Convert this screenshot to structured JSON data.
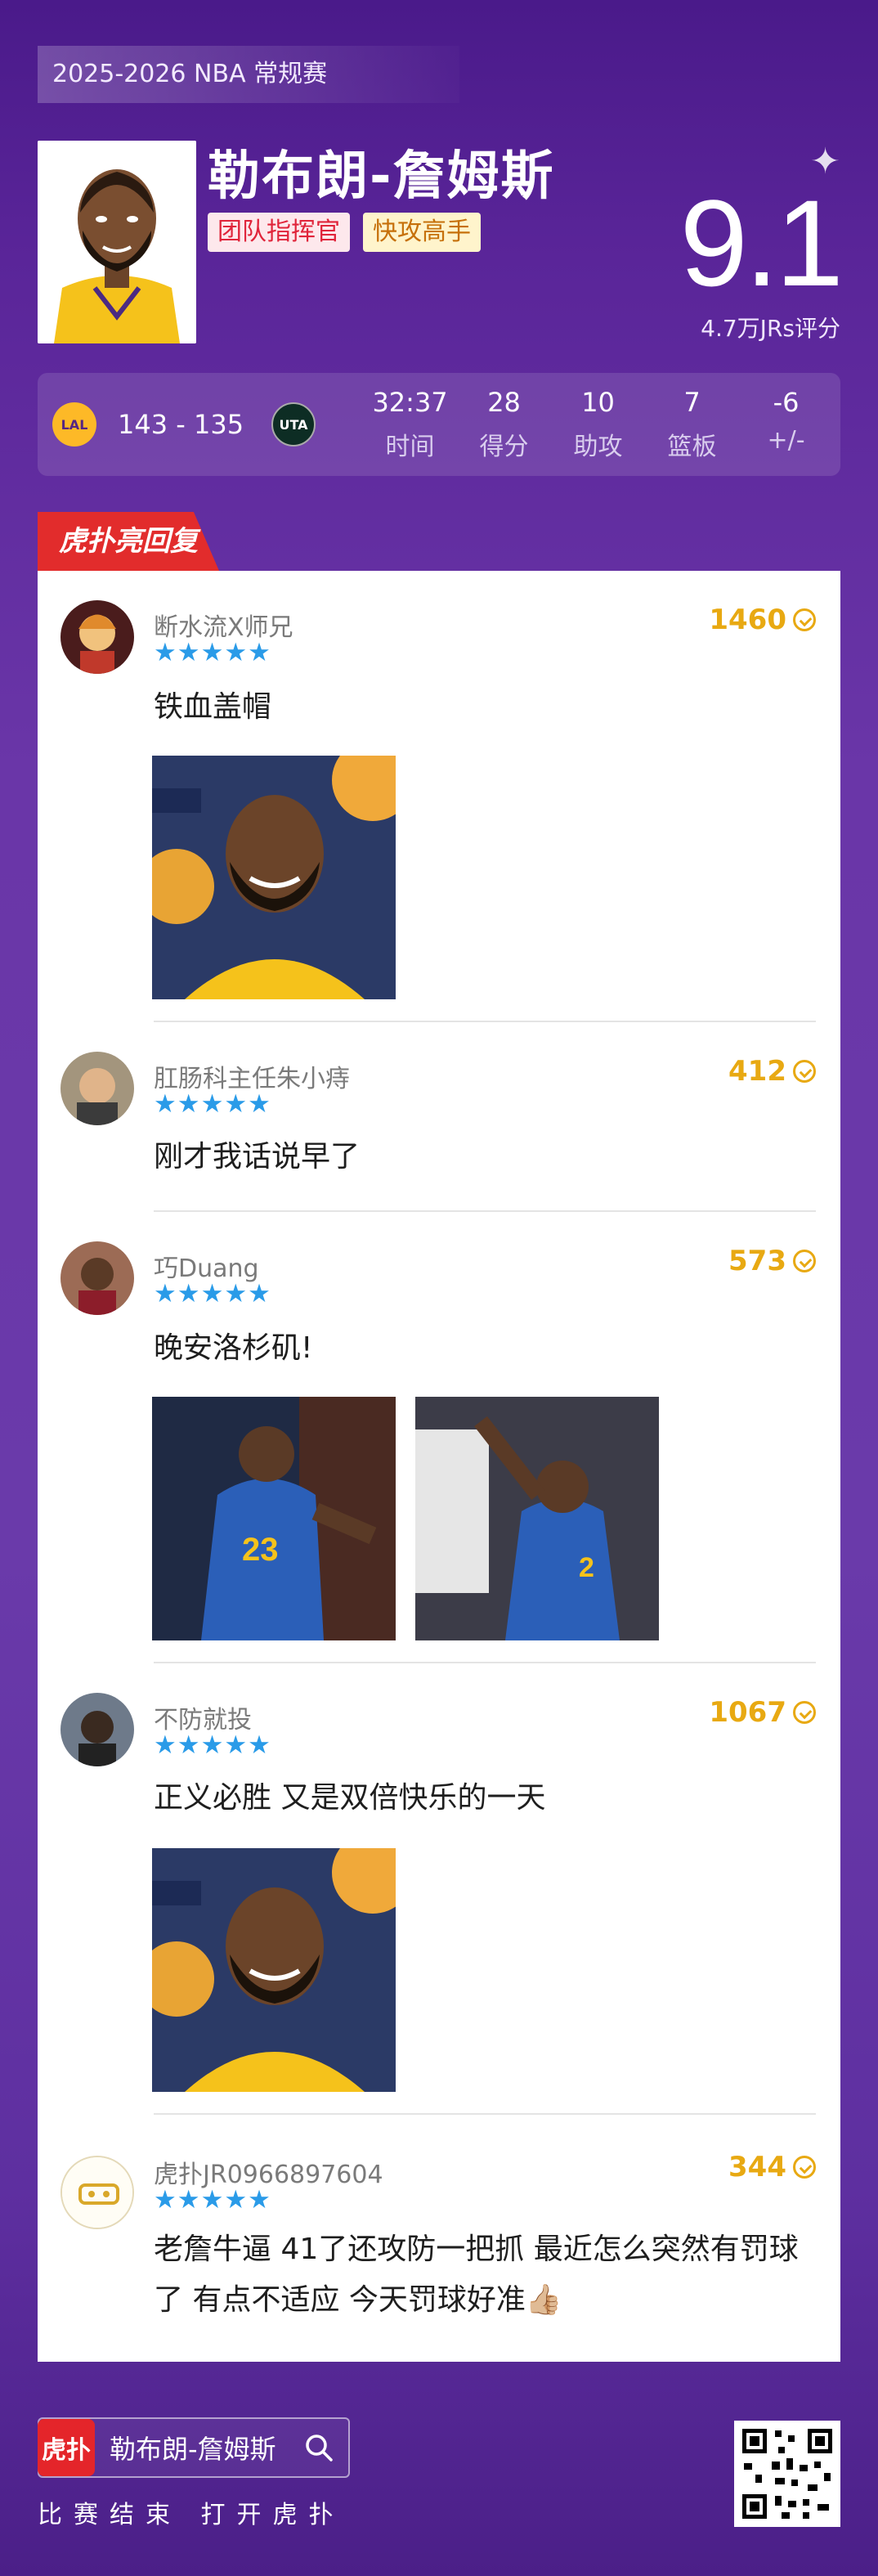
{
  "header": {
    "season": "2025-2026 NBA 常规赛",
    "player_name": "勒布朗-詹姆斯",
    "tags": [
      "团队指挥官",
      "快攻高手"
    ],
    "rating": "9.1",
    "rating_count": "4.7万JRs评分"
  },
  "game": {
    "home_team_icon": "lakers-logo",
    "away_team_icon": "jazz-logo",
    "score": "143 - 135",
    "stats": [
      {
        "value": "32:37",
        "label": "时间"
      },
      {
        "value": "28",
        "label": "得分"
      },
      {
        "value": "10",
        "label": "助攻"
      },
      {
        "value": "7",
        "label": "篮板"
      },
      {
        "value": "-6",
        "label": "+/-"
      }
    ]
  },
  "section_title": "虎扑亮回复",
  "comments": [
    {
      "username": "断水流X师兄",
      "stars": "★★★★★",
      "likes": "1460",
      "text": "铁血盖帽"
    },
    {
      "username": "肛肠科主任朱小痔",
      "stars": "★★★★★",
      "likes": "412",
      "text": "刚才我话说早了"
    },
    {
      "username": "巧Duang",
      "stars": "★★★★★",
      "likes": "573",
      "text": "晚安洛杉矶!"
    },
    {
      "username": "不防就投",
      "stars": "★★★★★",
      "likes": "1067",
      "text": "正义必胜 又是双倍快乐的一天"
    },
    {
      "username": "虎扑JR0966897604",
      "stars": "★★★★★",
      "likes": "344",
      "text": "老詹牛逼 41了还攻防一把抓 最近怎么突然有罚球了 有点不适应 今天罚球好准👍🏼"
    }
  ],
  "footer": {
    "logo_text": "虎扑",
    "app_player_name": "勒布朗-詹姆斯",
    "cta": "比赛结束 打开虎扑"
  }
}
